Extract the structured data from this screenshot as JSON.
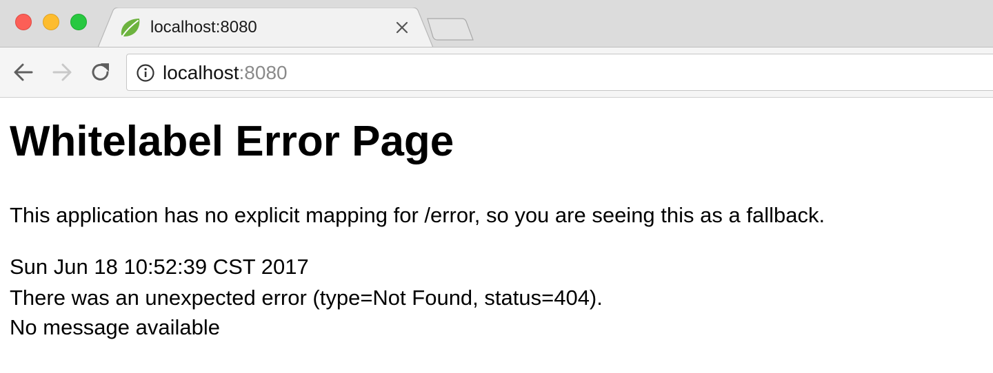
{
  "browser": {
    "tab": {
      "title": "localhost:8080",
      "favicon": "spring-leaf-icon"
    },
    "address_bar": {
      "host": "localhost",
      "port": ":8080",
      "security_icon": "info-icon"
    },
    "nav": {
      "back_icon": "arrow-left-icon",
      "forward_icon": "arrow-right-icon",
      "reload_icon": "reload-icon"
    },
    "colors": {
      "traffic_close": "#fc5f57",
      "traffic_minimize": "#fdbc2e",
      "traffic_maximize": "#28c840",
      "favicon_green": "#6db33f"
    }
  },
  "page": {
    "heading": "Whitelabel Error Page",
    "description": "This application has no explicit mapping for /error, so you are seeing this as a fallback.",
    "timestamp": "Sun Jun 18 10:52:39 CST 2017",
    "error_line": "There was an unexpected error (type=Not Found, status=404).",
    "message": "No message available"
  }
}
